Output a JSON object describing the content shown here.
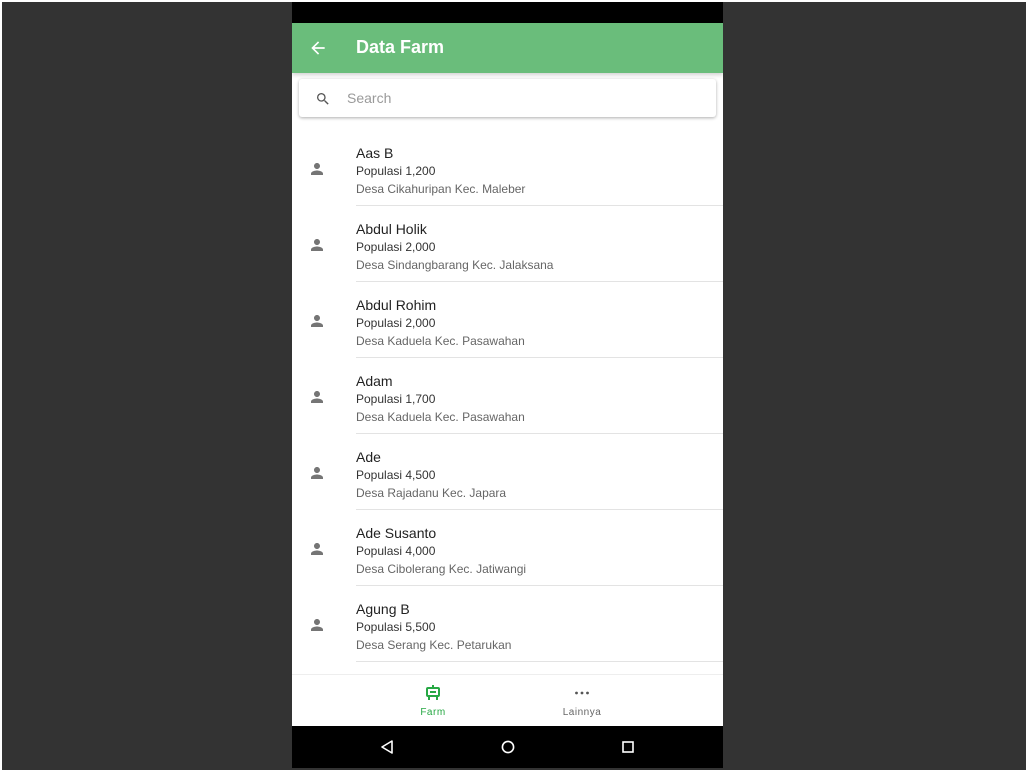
{
  "app_bar": {
    "title": "Data Farm",
    "back_icon": "arrow-back-icon"
  },
  "search": {
    "placeholder": "Search",
    "value": "",
    "icon": "search-icon"
  },
  "farms": [
    {
      "name": "Aas B",
      "population": "Populasi 1,200",
      "address": "Desa Cikahuripan Kec. Maleber"
    },
    {
      "name": "Abdul Holik",
      "population": "Populasi 2,000",
      "address": "Desa Sindangbarang Kec. Jalaksana"
    },
    {
      "name": "Abdul Rohim",
      "population": "Populasi 2,000",
      "address": "Desa Kaduela Kec. Pasawahan"
    },
    {
      "name": "Adam",
      "population": "Populasi 1,700",
      "address": "Desa Kaduela Kec. Pasawahan"
    },
    {
      "name": "Ade",
      "population": "Populasi 4,500",
      "address": "Desa Rajadanu Kec. Japara"
    },
    {
      "name": "Ade Susanto",
      "population": "Populasi 4,000",
      "address": "Desa Cibolerang Kec. Jatiwangi"
    },
    {
      "name": "Agung B",
      "population": "Populasi 5,500",
      "address": "Desa Serang Kec. Petarukan"
    }
  ],
  "bottom_nav": {
    "items": [
      {
        "label": "Farm",
        "icon": "farm-icon",
        "active": true
      },
      {
        "label": "Lainnya",
        "icon": "more-horizontal-icon",
        "active": false
      }
    ]
  },
  "colors": {
    "app_bar": "#6abd7b",
    "active_nav": "#27a844",
    "backdrop": "#333333",
    "icon_gray": "#757575"
  }
}
